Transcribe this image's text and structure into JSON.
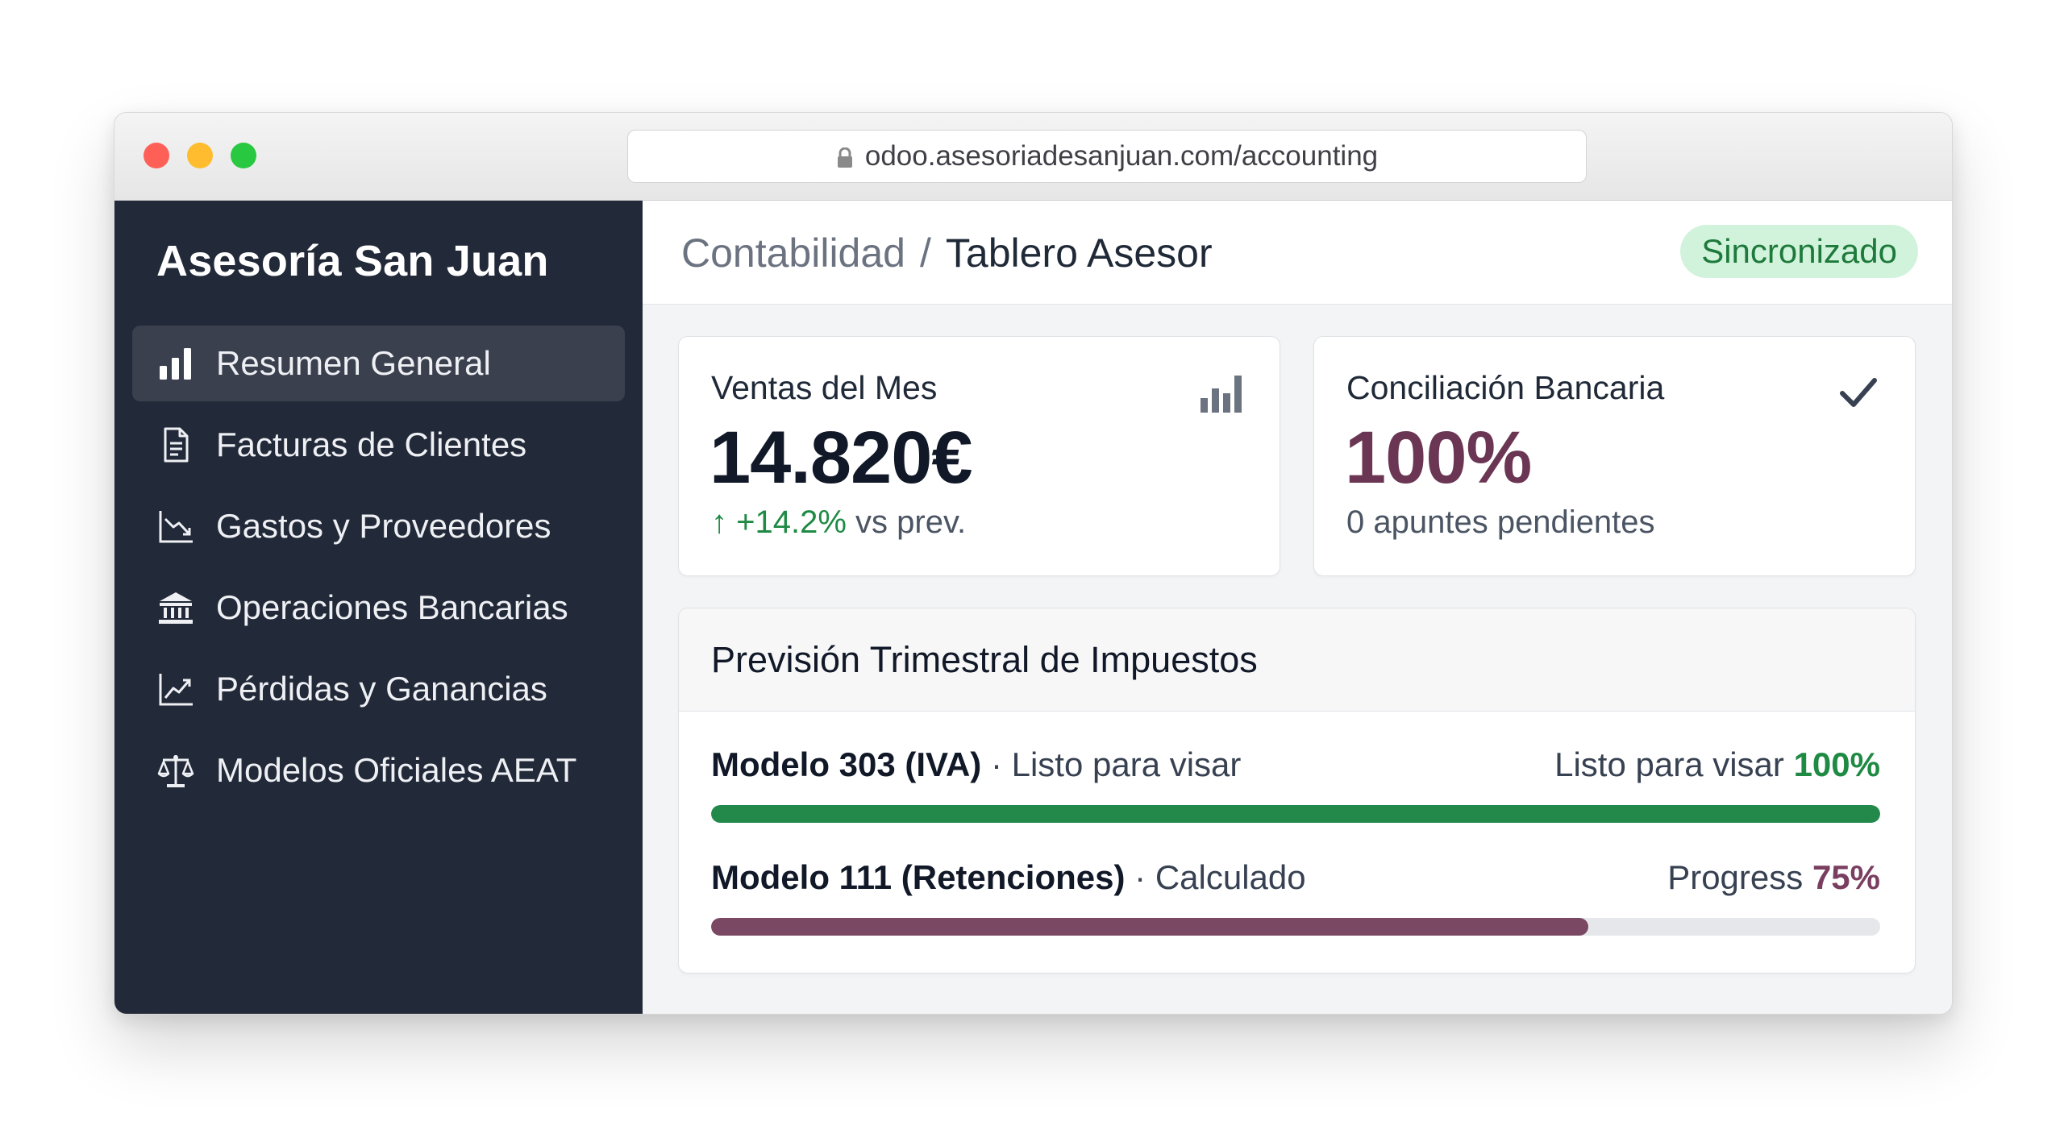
{
  "browser": {
    "url": "odoo.asesoriadesanjuan.com/accounting"
  },
  "sidebar": {
    "brand": "Asesoría San Juan",
    "items": [
      {
        "label": "Resumen General",
        "icon": "bar-chart-icon",
        "active": true
      },
      {
        "label": "Facturas de Clientes",
        "icon": "document-icon",
        "active": false
      },
      {
        "label": "Gastos y Proveedores",
        "icon": "trend-down-icon",
        "active": false
      },
      {
        "label": "Operaciones Bancarias",
        "icon": "bank-icon",
        "active": false
      },
      {
        "label": "Pérdidas y Ganancias",
        "icon": "trend-up-icon",
        "active": false
      },
      {
        "label": "Modelos Oficiales AEAT",
        "icon": "scale-icon",
        "active": false
      }
    ]
  },
  "header": {
    "breadcrumb_parent": "Contabilidad",
    "breadcrumb_separator": "/",
    "breadcrumb_current": "Tablero Asesor",
    "status_badge": "Sincronizado"
  },
  "kpis": {
    "sales": {
      "title": "Ventas del Mes",
      "value": "14.820€",
      "arrow": "↑",
      "change": "+14.2%",
      "change_suffix": "vs prev.",
      "icon": "bar-chart-icon"
    },
    "reconciliation": {
      "title": "Conciliación Bancaria",
      "value": "100%",
      "subtitle": "0 apuntes pendientes",
      "icon": "checkmark-icon"
    }
  },
  "taxes": {
    "title": "Previsión Trimestral de Impuestos",
    "rows": [
      {
        "name": "Modelo 303 (IVA)",
        "separator": "·",
        "status": "Listo para visar",
        "right_label": "Listo para visar",
        "percent_label": "100%",
        "progress": 1.0
      },
      {
        "name": "Modelo 111 (Retenciones)",
        "separator": "·",
        "status": "Calculado",
        "right_label": "Progress",
        "percent_label": "75%",
        "progress": 0.75
      }
    ]
  },
  "colors": {
    "sidebar_bg": "#222938",
    "accent_green": "#23894a",
    "accent_purple": "#7a4862",
    "badge_bg": "#d1f3dc"
  }
}
